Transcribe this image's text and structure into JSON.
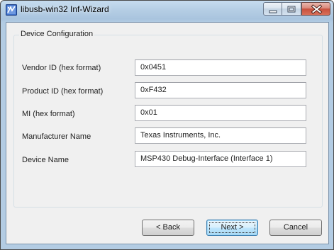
{
  "window": {
    "title": "libusb-win32 Inf-Wizard",
    "app_icon": "usb-device-icon",
    "controls": [
      "minimize-icon",
      "maximize-icon",
      "close-icon"
    ]
  },
  "group": {
    "title": "Device Configuration"
  },
  "fields": [
    {
      "label": "Vendor ID (hex format)",
      "value": "0x0451"
    },
    {
      "label": "Product ID (hex format)",
      "value": "0xF432"
    },
    {
      "label": "MI (hex format)",
      "value": "0x01"
    },
    {
      "label": "Manufacturer Name",
      "value": "Texas Instruments, Inc."
    },
    {
      "label": "Device Name",
      "value": "MSP430 Debug-Interface (Interface 1)"
    }
  ],
  "buttons": {
    "back": "< Back",
    "next": "Next >",
    "cancel": "Cancel"
  },
  "colors": {
    "titlebar": "#b4cde4",
    "dialog_background": "#f0f0f0",
    "default_button": "#bee6fd",
    "close_button": "#c8503c"
  }
}
